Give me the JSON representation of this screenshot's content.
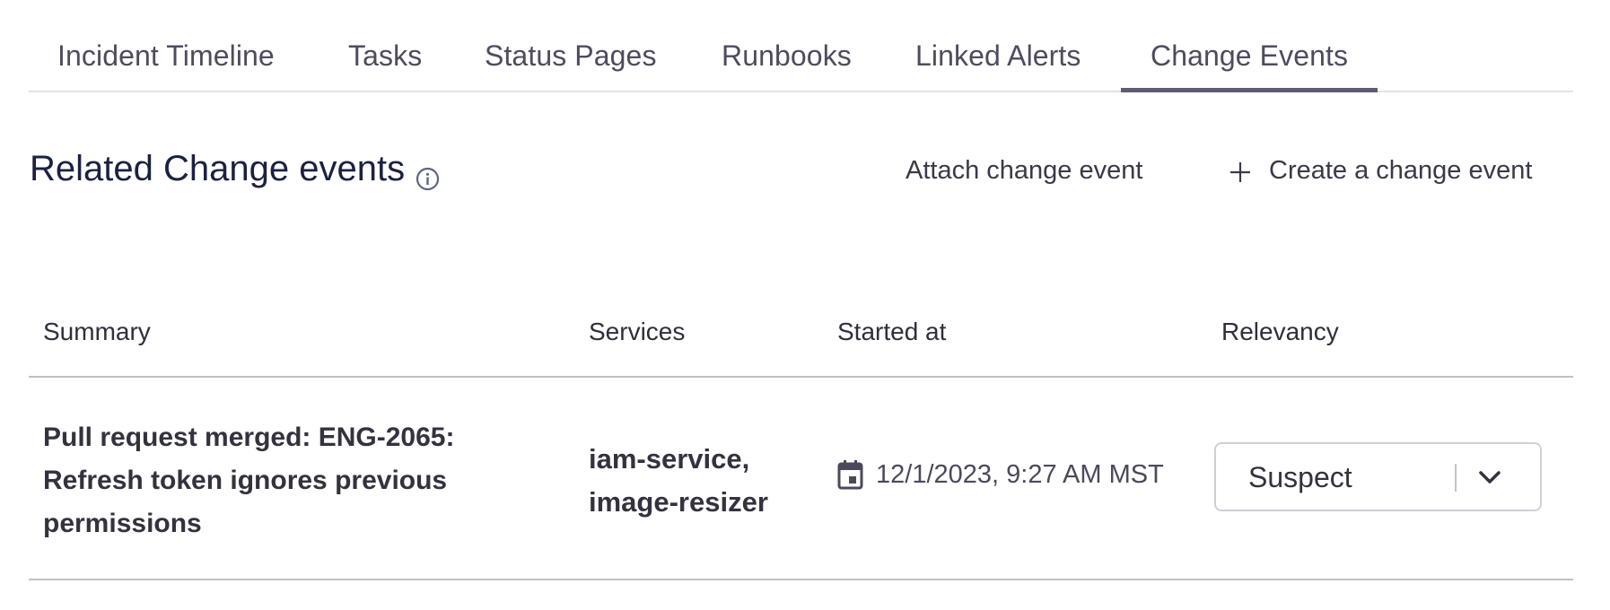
{
  "tabs": [
    {
      "label": "Incident Timeline",
      "active": false
    },
    {
      "label": "Tasks",
      "active": false
    },
    {
      "label": "Status Pages",
      "active": false
    },
    {
      "label": "Runbooks",
      "active": false
    },
    {
      "label": "Linked Alerts",
      "active": false
    },
    {
      "label": "Change Events",
      "active": true
    }
  ],
  "section": {
    "title": "Related Change events",
    "info_icon": "info-circle-icon",
    "attach_label": "Attach change event",
    "create_label": "Create a change event",
    "create_icon": "plus-icon"
  },
  "table": {
    "columns": [
      "Summary",
      "Services",
      "Started at",
      "Relevancy"
    ],
    "rows": [
      {
        "summary": "Pull request merged: ENG-2065: Refresh token ignores previous permissions",
        "services": [
          "iam-service,",
          "image-resizer"
        ],
        "started_at": "12/1/2023, 9:27 AM MST",
        "started_icon": "calendar-icon",
        "relevancy": "Suspect"
      }
    ]
  },
  "colors": {
    "tab_active_underline": "#5f5d74",
    "heading": "#1b2140",
    "text": "#33323f"
  }
}
